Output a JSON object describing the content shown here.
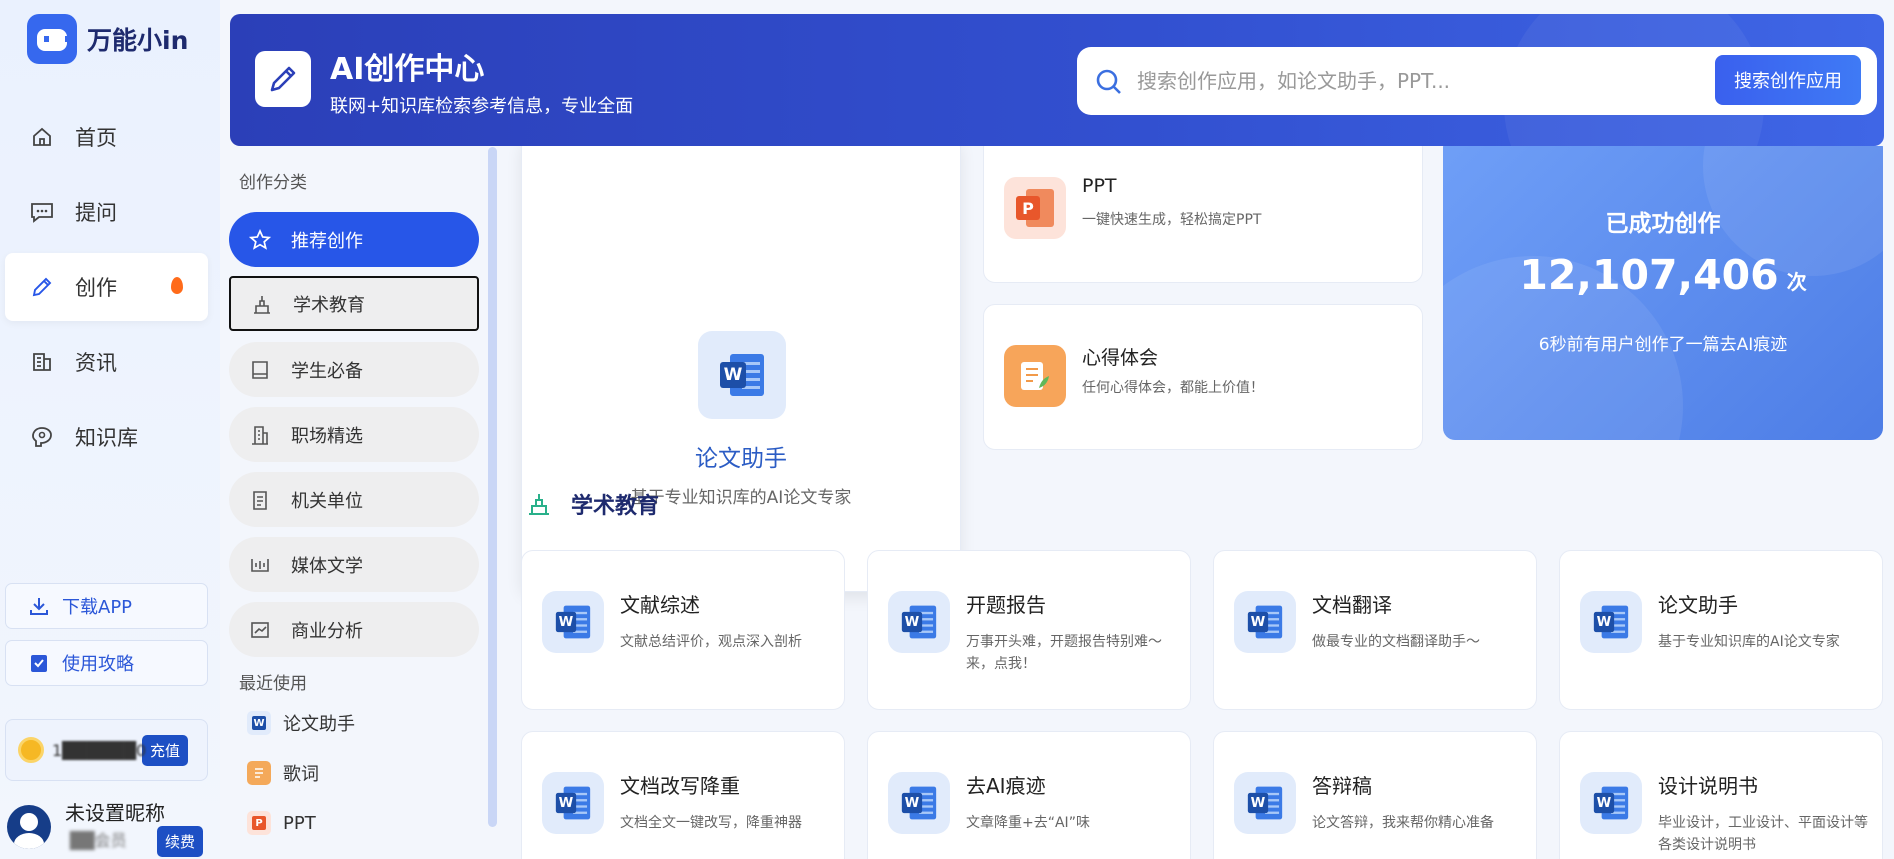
{
  "brand": {
    "name": "万能小in"
  },
  "nav": [
    {
      "label": "首页",
      "icon": "home-icon"
    },
    {
      "label": "提问",
      "icon": "chat-icon"
    },
    {
      "label": "创作",
      "icon": "pen-icon",
      "active": true,
      "badge": "fire-icon"
    },
    {
      "label": "资讯",
      "icon": "news-icon"
    },
    {
      "label": "知识库",
      "icon": "knowledge-icon"
    }
  ],
  "side_buttons": {
    "download": "下载APP",
    "guide": "使用攻略"
  },
  "account": {
    "coins": "1██████0",
    "recharge": "充值",
    "nickname": "未设置昵称",
    "role": "██会员",
    "renew": "续费"
  },
  "header": {
    "title": "AI创作中心",
    "subtitle": "联网+知识库检索参考信息，专业全面",
    "search_placeholder": "搜索创作应用，如论文助手，PPT...",
    "search_button": "搜索创作应用",
    "accent": "#2b3fb8"
  },
  "categories": {
    "heading": "创作分类",
    "items": [
      {
        "label": "推荐创作",
        "icon": "star-icon"
      },
      {
        "label": "学术教育",
        "icon": "academic-icon"
      },
      {
        "label": "学生必备",
        "icon": "book-icon"
      },
      {
        "label": "职场精选",
        "icon": "building-icon"
      },
      {
        "label": "机关单位",
        "icon": "document-icon"
      },
      {
        "label": "媒体文学",
        "icon": "media-icon"
      },
      {
        "label": "商业分析",
        "icon": "chart-icon"
      }
    ],
    "recent_heading": "最近使用",
    "recent": [
      {
        "label": "论文助手",
        "icon": "word-icon"
      },
      {
        "label": "歌词",
        "icon": "lyrics-icon"
      },
      {
        "label": "PPT",
        "icon": "ppt-icon"
      }
    ]
  },
  "featured": {
    "big": {
      "title": "论文助手",
      "desc": "基于专业知识库的AI论文专家"
    },
    "ppt": {
      "title": "PPT",
      "desc": "一键快速生成，轻松搞定PPT"
    },
    "xinde": {
      "title": "心得体会",
      "desc": "任何心得体会，都能上价值！"
    },
    "stats": {
      "label": "已成功创作",
      "count": "12,107,406",
      "unit": "次",
      "caption": "6秒前有用户创作了一篇去AI痕迹"
    }
  },
  "section": {
    "title": "学术教育",
    "cards": [
      {
        "title": "文献综述",
        "desc": "文献总结评价，观点深入剖析"
      },
      {
        "title": "开题报告",
        "desc": "万事开头难，开题报告特别难～来，点我！"
      },
      {
        "title": "文档翻译",
        "desc": "做最专业的文档翻译助手～"
      },
      {
        "title": "论文助手",
        "desc": "基于专业知识库的AI论文专家"
      },
      {
        "title": "文档改写降重",
        "desc": "文档全文一键改写，降重神器"
      },
      {
        "title": "去AI痕迹",
        "desc": "文章降重+去“AI”味"
      },
      {
        "title": "答辩稿",
        "desc": "论文答辩，我来帮你精心准备"
      },
      {
        "title": "设计说明书",
        "desc": "毕业设计，工业设计、平面设计等各类设计说明书"
      }
    ]
  }
}
